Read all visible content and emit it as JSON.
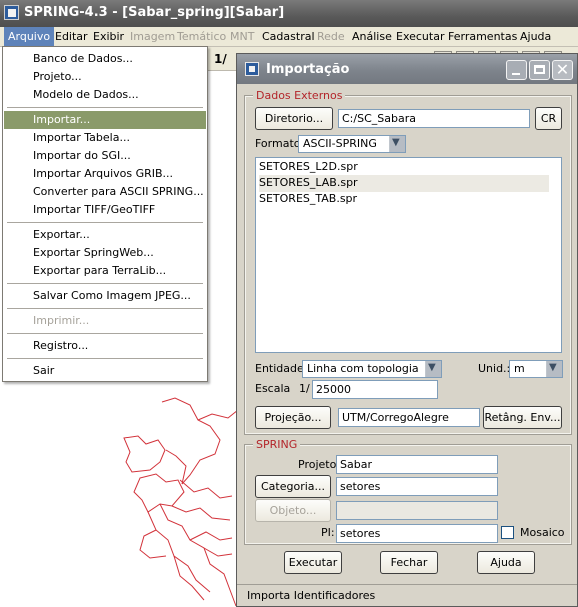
{
  "window": {
    "title": "SPRING-4.3 - [Sabar_spring][Sabar]"
  },
  "menubar": {
    "items": [
      {
        "label": "Arquivo",
        "enabled": true
      },
      {
        "label": "Editar",
        "enabled": true
      },
      {
        "label": "Exibir",
        "enabled": true
      },
      {
        "label": "Imagem",
        "enabled": false
      },
      {
        "label": "Temático",
        "enabled": false
      },
      {
        "label": "MNT",
        "enabled": false
      },
      {
        "label": "Cadastral",
        "enabled": true
      },
      {
        "label": "Rede",
        "enabled": false
      },
      {
        "label": "Análise",
        "enabled": true
      },
      {
        "label": "Executar",
        "enabled": true
      },
      {
        "label": "Ferramentas",
        "enabled": true
      },
      {
        "label": "Ajuda",
        "enabled": true
      }
    ]
  },
  "toolbar": {
    "scale_prefix": "1/"
  },
  "arquivo_menu": {
    "items": [
      {
        "label": "Banco de Dados...",
        "enabled": true
      },
      {
        "label": "Projeto...",
        "enabled": true
      },
      {
        "label": "Modelo de Dados...",
        "enabled": true
      },
      {
        "label": "Importar...",
        "enabled": true,
        "selected": true
      },
      {
        "label": "Importar Tabela...",
        "enabled": true
      },
      {
        "label": "Importar do SGI...",
        "enabled": true
      },
      {
        "label": "Importar Arquivos GRIB...",
        "enabled": true
      },
      {
        "label": "Converter para ASCII SPRING...",
        "enabled": true
      },
      {
        "label": "Importar TIFF/GeoTIFF",
        "enabled": true
      },
      {
        "label": "Exportar...",
        "enabled": true
      },
      {
        "label": "Exportar SpringWeb...",
        "enabled": true
      },
      {
        "label": "Exportar para TerraLib...",
        "enabled": true
      },
      {
        "label": "Salvar Como Imagem JPEG...",
        "enabled": true
      },
      {
        "label": "Imprimir...",
        "enabled": false
      },
      {
        "label": "Registro...",
        "enabled": true
      },
      {
        "label": "Sair",
        "enabled": true
      }
    ]
  },
  "dialog": {
    "title": "Importação",
    "dados_externos": {
      "group_label": "Dados Externos",
      "diretorio_button": "Diretorio...",
      "path_value": "C:/SC_Sabara",
      "cr_button": "CR",
      "formato_label": "Formato:",
      "formato_value": "ASCII-SPRING",
      "files": [
        "SETORES_L2D.spr",
        "SETORES_LAB.spr",
        "SETORES_TAB.spr"
      ],
      "entidade_label": "Entidade:",
      "entidade_value": "Linha com topologia",
      "unid_label": "Unid.:",
      "unid_value": "m",
      "escala_label": "Escala",
      "escala_prefix": "1/",
      "escala_value": "25000",
      "projecao_button": "Projeção...",
      "projecao_value": "UTM/CorregoAlegre",
      "retang_button": "Retâng. Env..."
    },
    "spring": {
      "group_label": "SPRING",
      "projeto_label": "Projeto:",
      "projeto_value": "Sabar",
      "categoria_button": "Categoria...",
      "categoria_value": "setores",
      "objeto_button": "Objeto...",
      "objeto_value": "",
      "pi_label": "PI:",
      "pi_value": "setores",
      "mosaico_label": "Mosaico",
      "mosaico_checked": false
    },
    "buttons": {
      "executar": "Executar",
      "fechar": "Fechar",
      "ajuda": "Ajuda"
    },
    "status": "Importa Identificadores"
  },
  "colors": {
    "group_label": "#b3252a",
    "map_lines": "#d2323a",
    "menu_selection": "#8a9a6a"
  }
}
